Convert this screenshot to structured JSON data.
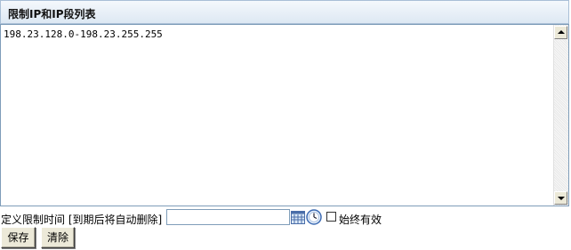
{
  "panel": {
    "title": "限制IP和IP段列表"
  },
  "ip_list": {
    "value": "198.23.128.0-198.23.255.255"
  },
  "time_limit": {
    "label": "定义限制时间 [到期后将自动删除]",
    "value": "",
    "calendar_icon": "calendar-icon",
    "clock_icon": "clock-icon",
    "always_valid_label": "始终有效",
    "always_valid_checked": false
  },
  "buttons": {
    "save_label": "保存",
    "clear_label": "清除"
  },
  "colors": {
    "header_border": "#a9bfd6",
    "input_border": "#7f9db9"
  }
}
